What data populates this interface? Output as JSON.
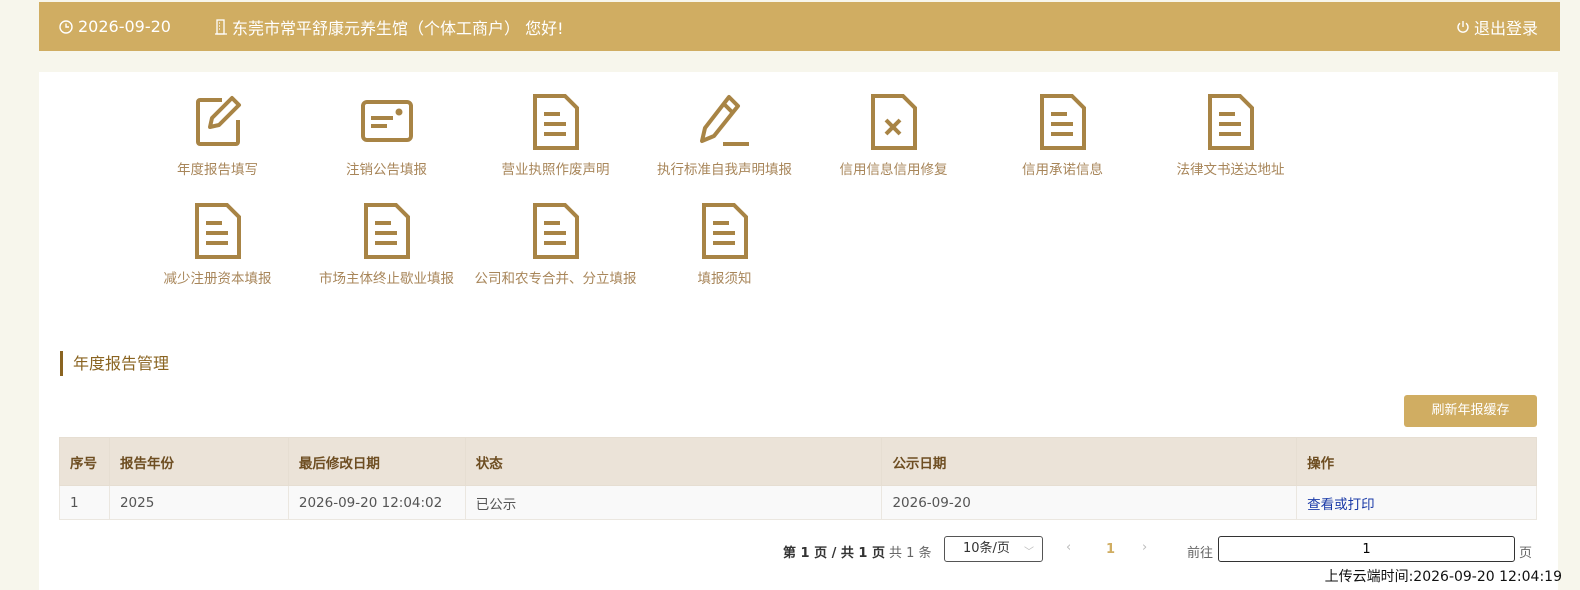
{
  "header": {
    "date": "2026-09-20",
    "greeting": "东莞市常平舒康元养生馆（个体工商户） 您好!",
    "logout_label": "退出登录"
  },
  "tiles": [
    {
      "label": "年度报告填写",
      "icon": "edit-icon"
    },
    {
      "label": "注销公告填报",
      "icon": "card-icon"
    },
    {
      "label": "营业执照作废声明",
      "icon": "document-icon"
    },
    {
      "label": "执行标准自我声明填报",
      "icon": "pencil-icon"
    },
    {
      "label": "信用信息信用修复",
      "icon": "document-x-icon"
    },
    {
      "label": "信用承诺信息",
      "icon": "document-icon"
    },
    {
      "label": "法律文书送达地址",
      "icon": "document-icon"
    },
    {
      "label": "减少注册资本填报",
      "icon": "document-icon"
    },
    {
      "label": "市场主体终止歇业填报",
      "icon": "document-icon"
    },
    {
      "label": "公司和农专合并、分立填报",
      "icon": "document-icon"
    },
    {
      "label": "填报须知",
      "icon": "document-icon"
    }
  ],
  "section": {
    "title": "年度报告管理",
    "refresh_label": "刷新年报缓存"
  },
  "table": {
    "columns": [
      "序号",
      "报告年份",
      "最后修改日期",
      "状态",
      "公示日期",
      "操作"
    ],
    "rows": [
      {
        "index": "1",
        "year": "2025",
        "modified": "2026-09-20 12:04:02",
        "status": "已公示",
        "publish_date": "2026-09-20",
        "action": "查看或打印"
      }
    ]
  },
  "pagination": {
    "page_info": "第 1 页 / 共 1 页",
    "total": "共 1 条",
    "page_size": "10条/页",
    "current_page": "1",
    "goto_label": "前往",
    "goto_value": "1",
    "unit": "页"
  },
  "footer": {
    "upload_time": "上传云端时间:2026-09-20 12:04:19"
  },
  "colors": {
    "accent": "#d0ad62",
    "tile_text": "#a8865a",
    "icon": "#a88445",
    "link": "#1a3aa8"
  }
}
